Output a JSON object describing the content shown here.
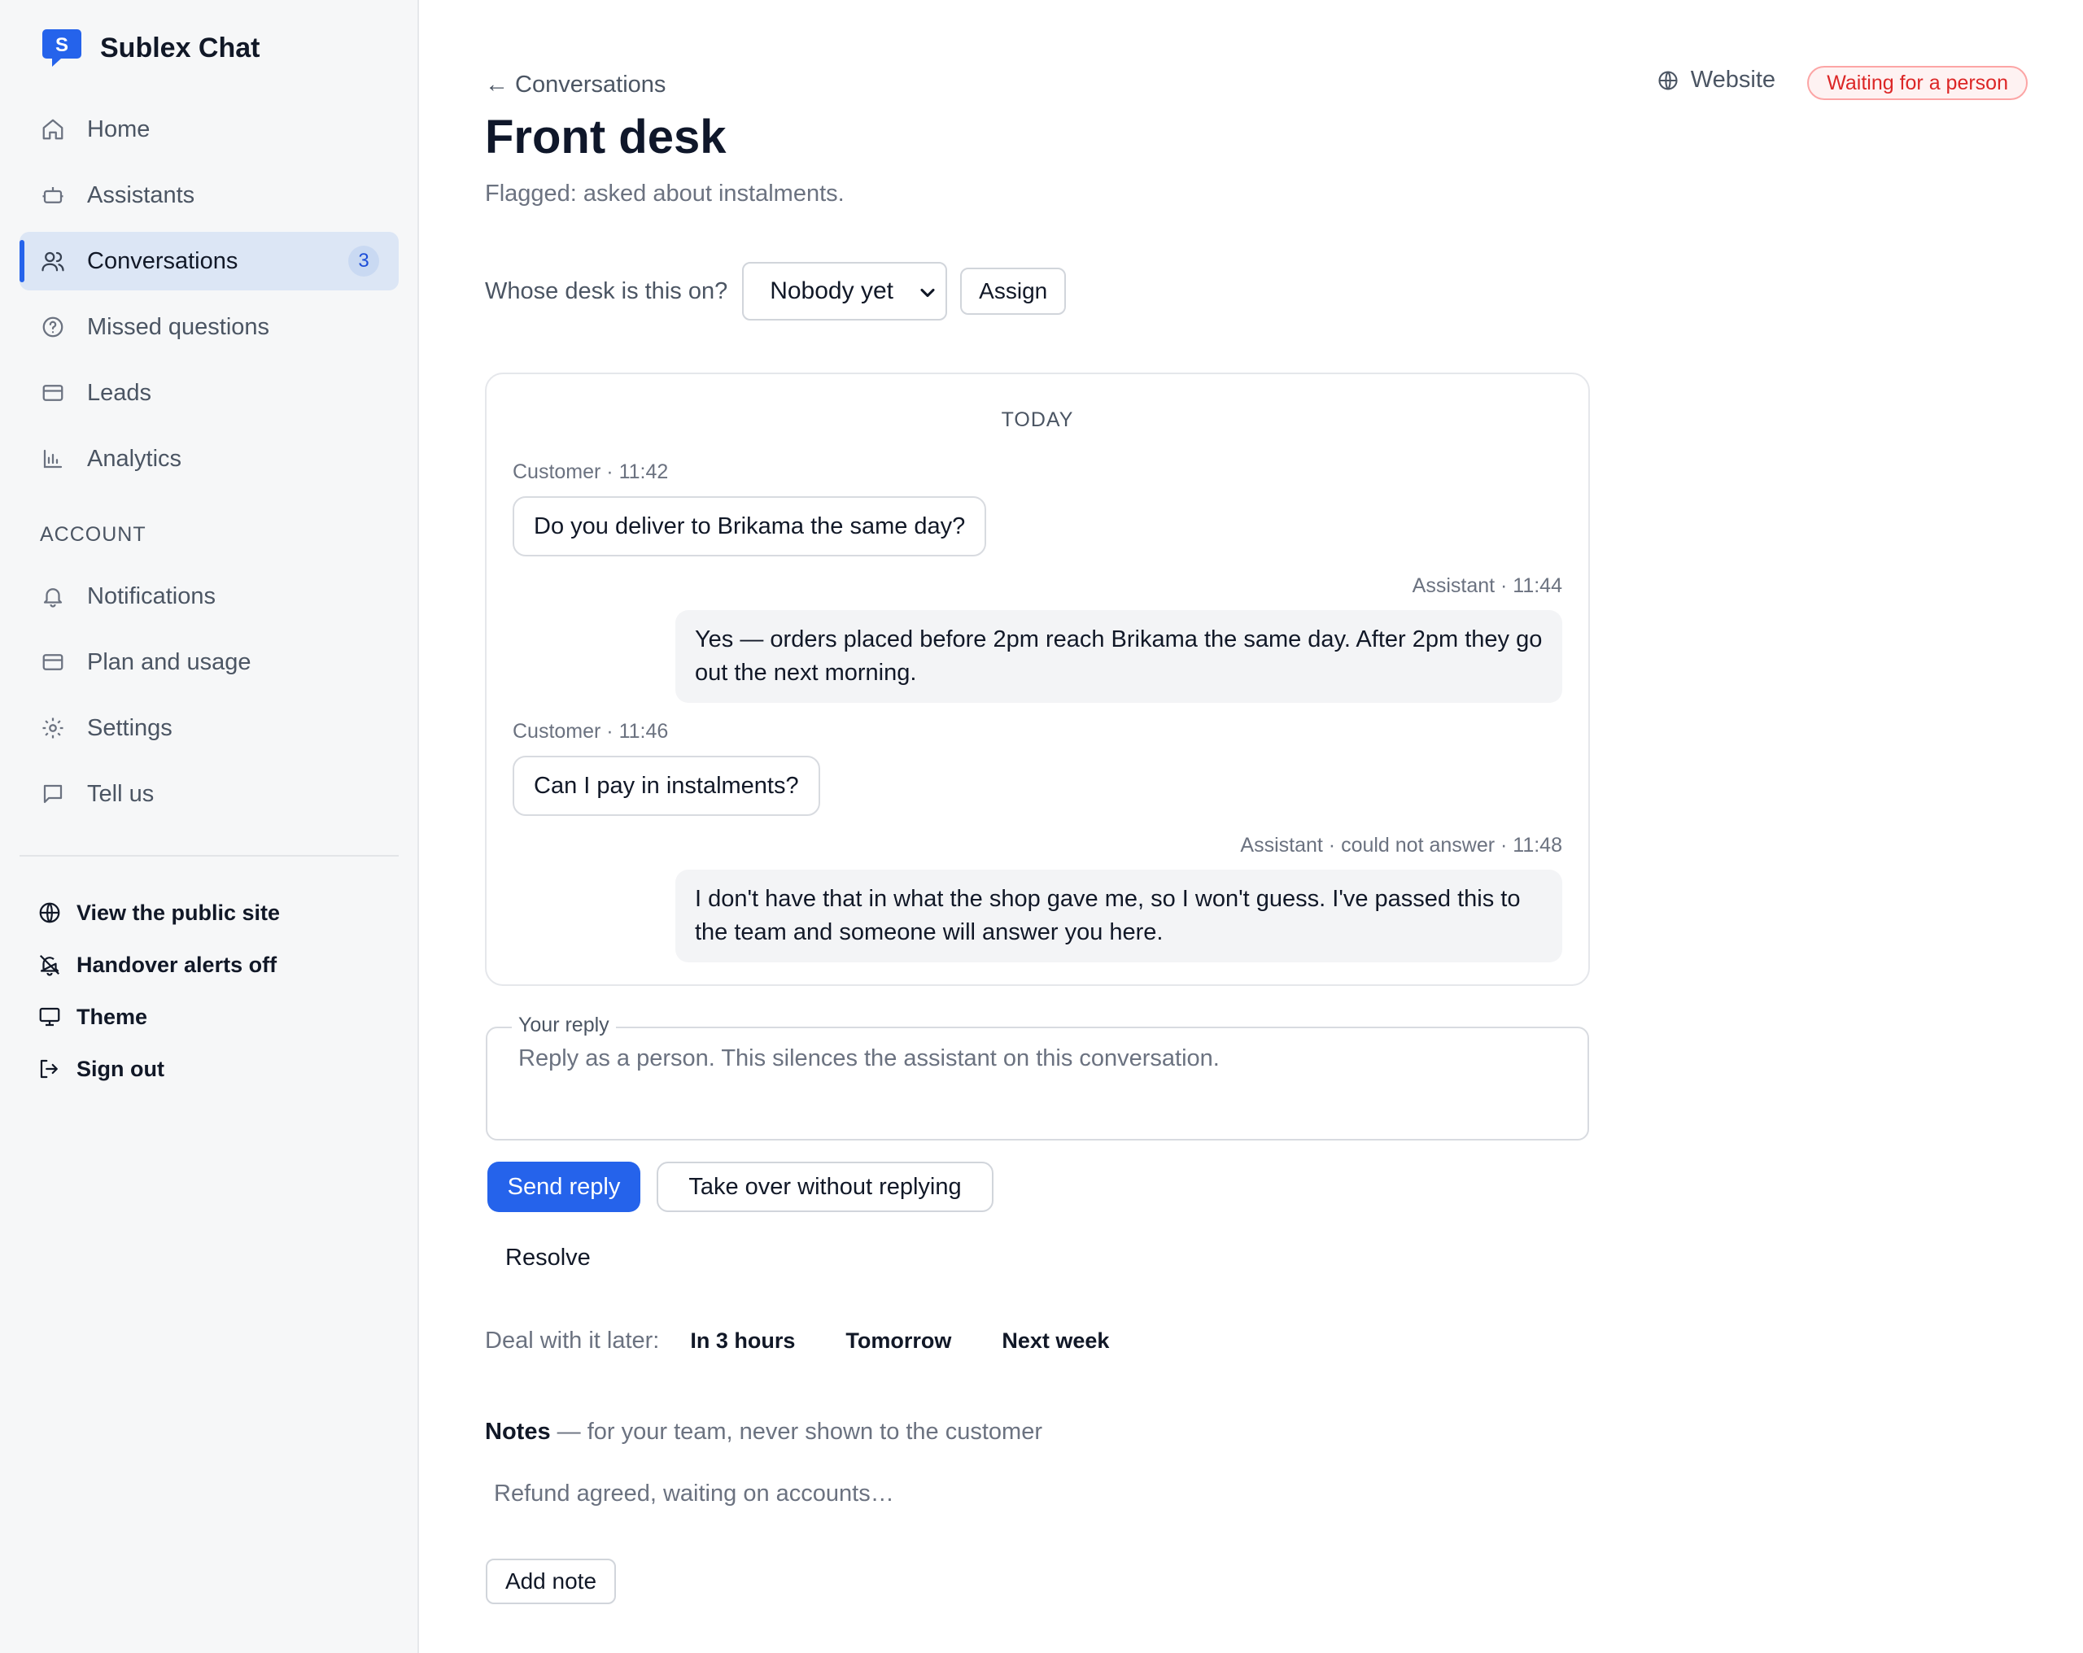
{
  "brand": {
    "name": "Sublex Chat",
    "logo_letter": "S",
    "color": "#2563eb"
  },
  "nav": {
    "items": [
      {
        "label": "Home",
        "icon": "home-icon"
      },
      {
        "label": "Assistants",
        "icon": "bot-icon"
      },
      {
        "label": "Conversations",
        "icon": "users-icon",
        "active": true,
        "badge": "3"
      },
      {
        "label": "Missed questions",
        "icon": "question-circle-icon"
      },
      {
        "label": "Leads",
        "icon": "card-icon"
      },
      {
        "label": "Analytics",
        "icon": "bar-chart-icon"
      }
    ],
    "account_label": "ACCOUNT",
    "account_items": [
      {
        "label": "Notifications",
        "icon": "bell-icon"
      },
      {
        "label": "Plan and usage",
        "icon": "card-icon"
      },
      {
        "label": "Settings",
        "icon": "gear-icon"
      },
      {
        "label": "Tell us",
        "icon": "message-square-icon"
      }
    ],
    "utility_items": [
      {
        "label": "View the public site",
        "icon": "globe-icon"
      },
      {
        "label": "Handover alerts off",
        "icon": "bell-off-icon"
      },
      {
        "label": "Theme",
        "icon": "monitor-icon"
      },
      {
        "label": "Sign out",
        "icon": "sign-out-icon"
      }
    ]
  },
  "header": {
    "back_label": "← Conversations",
    "title": "Front desk",
    "flag_text": "Flagged: asked about instalments.",
    "channel": "Website",
    "status": "Waiting for a person"
  },
  "assign": {
    "label": "Whose desk is this on?",
    "selected": "Nobody yet",
    "button": "Assign"
  },
  "chat": {
    "day_label": "TODAY",
    "messages": [
      {
        "from": "customer",
        "meta": "Customer · 11:42",
        "text": "Do you deliver to Brikama the same day?"
      },
      {
        "from": "assistant",
        "meta": "Assistant · 11:44",
        "text": "Yes — orders placed before 2pm reach Brikama the same day. After 2pm they go out the next morning."
      },
      {
        "from": "customer",
        "meta": "Customer · 11:46",
        "text": "Can I pay in instalments?"
      },
      {
        "from": "assistant",
        "meta": "Assistant · could not answer · 11:48",
        "text": "I don't have that in what the shop gave me, so I won't guess. I've passed this to the team and someone will answer you here."
      }
    ]
  },
  "reply": {
    "legend": "Your reply",
    "placeholder": "Reply as a person. This silences the assistant on this conversation.",
    "send_label": "Send reply",
    "takeover_label": "Take over without replying",
    "resolve_label": "Resolve"
  },
  "later": {
    "label": "Deal with it later:",
    "options": [
      "In 3 hours",
      "Tomorrow",
      "Next week"
    ]
  },
  "notes": {
    "title": "Notes",
    "subtitle": " — for your team, never shown to the customer",
    "placeholder": "Refund agreed, waiting on accounts…",
    "add_label": "Add note"
  }
}
